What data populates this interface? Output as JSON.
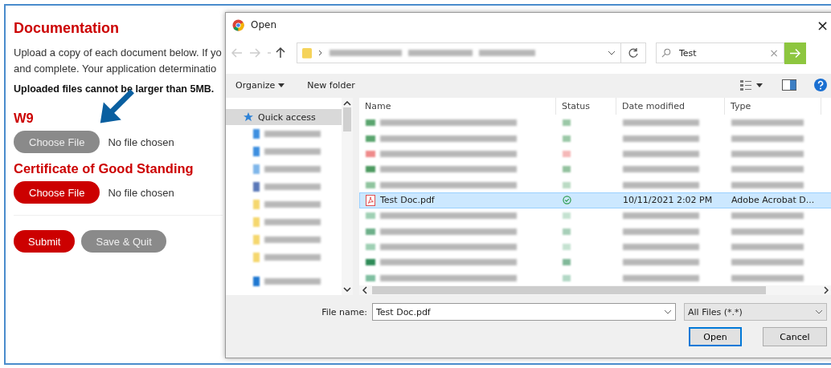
{
  "page": {
    "heading": "Documentation",
    "intro_lines": [
      "Upload a copy of each document below. If yo",
      "and complete. Your application determinatio"
    ],
    "size_note": "Uploaded files cannot be larger than 5MB.",
    "uploads": [
      {
        "title": "W9",
        "button": "Choose File",
        "status": "No file chosen",
        "highlighted": true
      },
      {
        "title": "Certificate of Good Standing",
        "button": "Choose File",
        "status": "No file chosen",
        "highlighted": false
      }
    ],
    "actions": [
      {
        "label": "Submit",
        "kind": "primary"
      },
      {
        "label": "Save & Quit",
        "kind": "secondary"
      }
    ]
  },
  "dialog": {
    "title": "Open",
    "close": "×",
    "search": {
      "value": "Test",
      "clear": "×"
    },
    "toolbar": {
      "organize": "Organize",
      "new_folder": "New folder"
    },
    "nav_items": [
      {
        "kind": "item",
        "label": "Quick access",
        "selected": true
      },
      {
        "kind": "blurred",
        "color": "#3d8fe0"
      },
      {
        "kind": "blurred",
        "color": "#3d8fe0"
      },
      {
        "kind": "blurred",
        "color": "#7fb6ea"
      },
      {
        "kind": "blurred",
        "color": "#5a78b8"
      },
      {
        "kind": "blurred",
        "color": "#f5d76e"
      },
      {
        "kind": "blurred",
        "color": "#f5d76e"
      },
      {
        "kind": "blurred",
        "color": "#f5d76e"
      },
      {
        "kind": "blurred",
        "color": "#f5d76e"
      },
      {
        "kind": "gap"
      },
      {
        "kind": "blurred",
        "color": "#1f78d1"
      }
    ],
    "columns": [
      "Name",
      "Status",
      "Date modified",
      "Type"
    ],
    "rows": [
      {
        "kind": "blurred",
        "color": "#5aa56e"
      },
      {
        "kind": "blurred",
        "color": "#5aa56e"
      },
      {
        "kind": "blurred",
        "color": "#ef8a8a"
      },
      {
        "kind": "blurred",
        "color": "#4d9a60"
      },
      {
        "kind": "blurred",
        "color": "#8fc49e"
      },
      {
        "kind": "file",
        "name": "Test Doc.pdf",
        "date": "10/11/2021 2:02 PM",
        "type": "Adobe Acrobat D...",
        "synced": true,
        "selected": true
      },
      {
        "kind": "blurred",
        "color": "#9fd0b4"
      },
      {
        "kind": "blurred",
        "color": "#6db08a"
      },
      {
        "kind": "blurred",
        "color": "#9fd0b4"
      },
      {
        "kind": "blurred",
        "color": "#2e8b57"
      },
      {
        "kind": "blurred",
        "color": "#7fbfa0"
      }
    ],
    "file_name_label": "File name:",
    "file_name": "Test Doc.pdf",
    "filter": "All Files (*.*)",
    "open": "Open",
    "cancel": "Cancel"
  }
}
